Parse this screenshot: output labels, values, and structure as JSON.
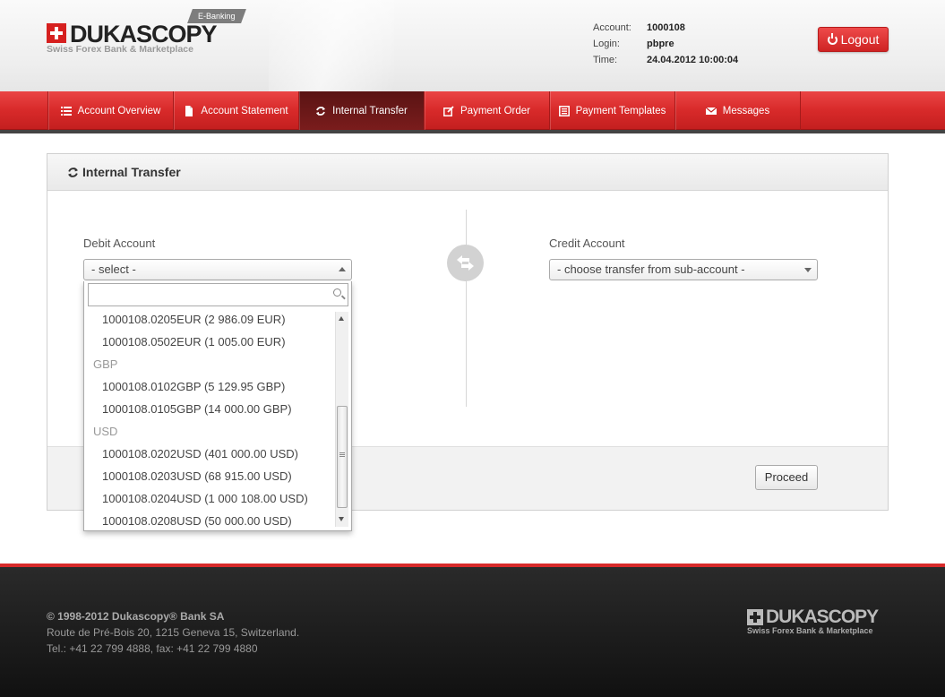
{
  "brand": {
    "logo_word": "DUKASCOPY",
    "logo_tagline": "Swiss Forex Bank & Marketplace",
    "ebanking_badge": "E-Banking",
    "accent_color": "#d82a2a"
  },
  "account_info": {
    "account_label": "Account:",
    "account_value": "1000108",
    "login_label": "Login:",
    "login_value": "pbpre",
    "time_label": "Time:",
    "time_value": "24.04.2012 10:00:04"
  },
  "logout": {
    "label": "Logout",
    "icon": "power-icon"
  },
  "nav": {
    "items": [
      {
        "label": "Account Overview",
        "icon": "list-icon",
        "active": false
      },
      {
        "label": "Account Statement",
        "icon": "document-icon",
        "active": false
      },
      {
        "label": "Internal Transfer",
        "icon": "refresh-icon",
        "active": true
      },
      {
        "label": "Payment Order",
        "icon": "edit-icon",
        "active": false
      },
      {
        "label": "Payment Templates",
        "icon": "template-icon",
        "active": false
      },
      {
        "label": "Messages",
        "icon": "envelope-icon",
        "active": false
      }
    ]
  },
  "panel": {
    "title": "Internal Transfer",
    "debit": {
      "label": "Debit Account",
      "selected": "- select -",
      "search_value": "",
      "options": [
        {
          "type": "option",
          "text": "1000108.0205EUR (2 986.09 EUR)"
        },
        {
          "type": "option",
          "text": "1000108.0502EUR (1 005.00 EUR)"
        },
        {
          "type": "group",
          "text": "GBP"
        },
        {
          "type": "option",
          "text": "1000108.0102GBP (5 129.95 GBP)"
        },
        {
          "type": "option",
          "text": "1000108.0105GBP (14 000.00 GBP)"
        },
        {
          "type": "group",
          "text": "USD"
        },
        {
          "type": "option",
          "text": "1000108.0202USD (401 000.00 USD)"
        },
        {
          "type": "option",
          "text": "1000108.0203USD (68 915.00 USD)"
        },
        {
          "type": "option",
          "text": "1000108.0204USD (1 000 108.00 USD)"
        },
        {
          "type": "option",
          "text": "1000108.0208USD (50 000.00 USD)"
        }
      ]
    },
    "credit": {
      "label": "Credit Account",
      "selected": "- choose transfer from sub-account -"
    },
    "proceed_label": "Proceed"
  },
  "footer": {
    "copyright": "© 1998-2012 Dukascopy® Bank SA",
    "address": "Route de Pré-Bois 20, 1215 Geneva 15, Switzerland.",
    "phone": "Tel.: +41 22 799 4888, fax: +41 22 799 4880",
    "logo_word": "DUKASCOPY",
    "logo_tagline": "Swiss Forex Bank & Marketplace"
  }
}
